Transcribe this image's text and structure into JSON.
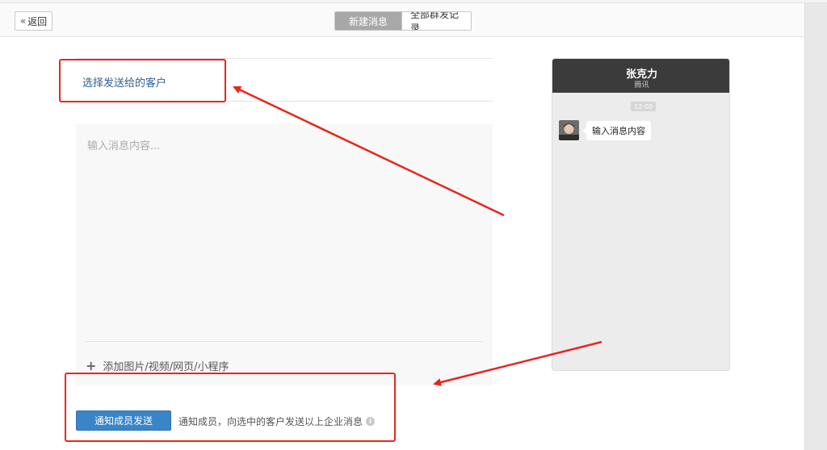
{
  "header": {
    "back_label": "返回",
    "tabs": [
      {
        "label": "新建消息",
        "active": true
      },
      {
        "label": "全部群发记录",
        "active": false
      }
    ]
  },
  "recipient": {
    "label": "选择发送给的客户"
  },
  "editor": {
    "placeholder": "输入消息内容...",
    "attach_label": "添加图片/视频/网页/小程序"
  },
  "footer": {
    "notify_button": "通知成员发送",
    "notify_desc": "通知成员，向选中的客户发送以上企业消息"
  },
  "preview": {
    "name": "张克力",
    "company": "腾讯",
    "time": "12:00",
    "message": "输入消息内容"
  },
  "colors": {
    "accent": "#3a84c8",
    "annotation": "#e8261e",
    "link": "#2f5f93"
  },
  "icons": {
    "back": "chevron-double-left-icon",
    "attach": "plus-icon",
    "info": "info-circle-icon"
  }
}
